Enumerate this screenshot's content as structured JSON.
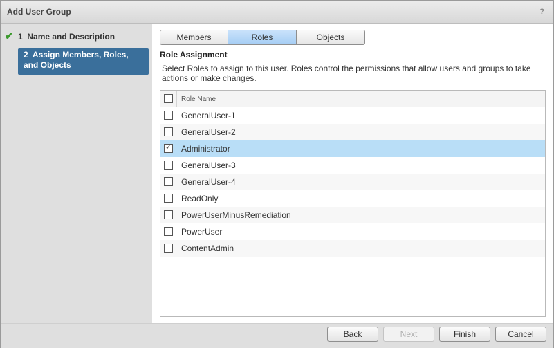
{
  "dialog": {
    "title": "Add User Group",
    "help_label": "?"
  },
  "steps": [
    {
      "number": "1",
      "label": "Name and Description",
      "done": true
    },
    {
      "number": "2",
      "label": "Assign Members, Roles, and Objects",
      "active": true
    }
  ],
  "tabs": [
    {
      "label": "Members",
      "active": false
    },
    {
      "label": "Roles",
      "active": true
    },
    {
      "label": "Objects",
      "active": false
    }
  ],
  "section": {
    "title": "Role Assignment",
    "description": "Select Roles to assign to this user. Roles control the permissions that allow users and groups to take actions or make changes."
  },
  "grid": {
    "column_header": "Role Name",
    "rows": [
      {
        "name": "GeneralUser-1",
        "checked": false
      },
      {
        "name": "GeneralUser-2",
        "checked": false
      },
      {
        "name": "Administrator",
        "checked": true,
        "selected": true
      },
      {
        "name": "GeneralUser-3",
        "checked": false
      },
      {
        "name": "GeneralUser-4",
        "checked": false
      },
      {
        "name": "ReadOnly",
        "checked": false
      },
      {
        "name": "PowerUserMinusRemediation",
        "checked": false
      },
      {
        "name": "PowerUser",
        "checked": false
      },
      {
        "name": "ContentAdmin",
        "checked": false
      }
    ]
  },
  "footer": {
    "back": "Back",
    "next": "Next",
    "finish": "Finish",
    "cancel": "Cancel"
  },
  "colors": {
    "active_step": "#3a6f9b",
    "active_tab": "#a5cdf4",
    "selected_row": "#b9def7",
    "check_green": "#3c9a2e"
  }
}
